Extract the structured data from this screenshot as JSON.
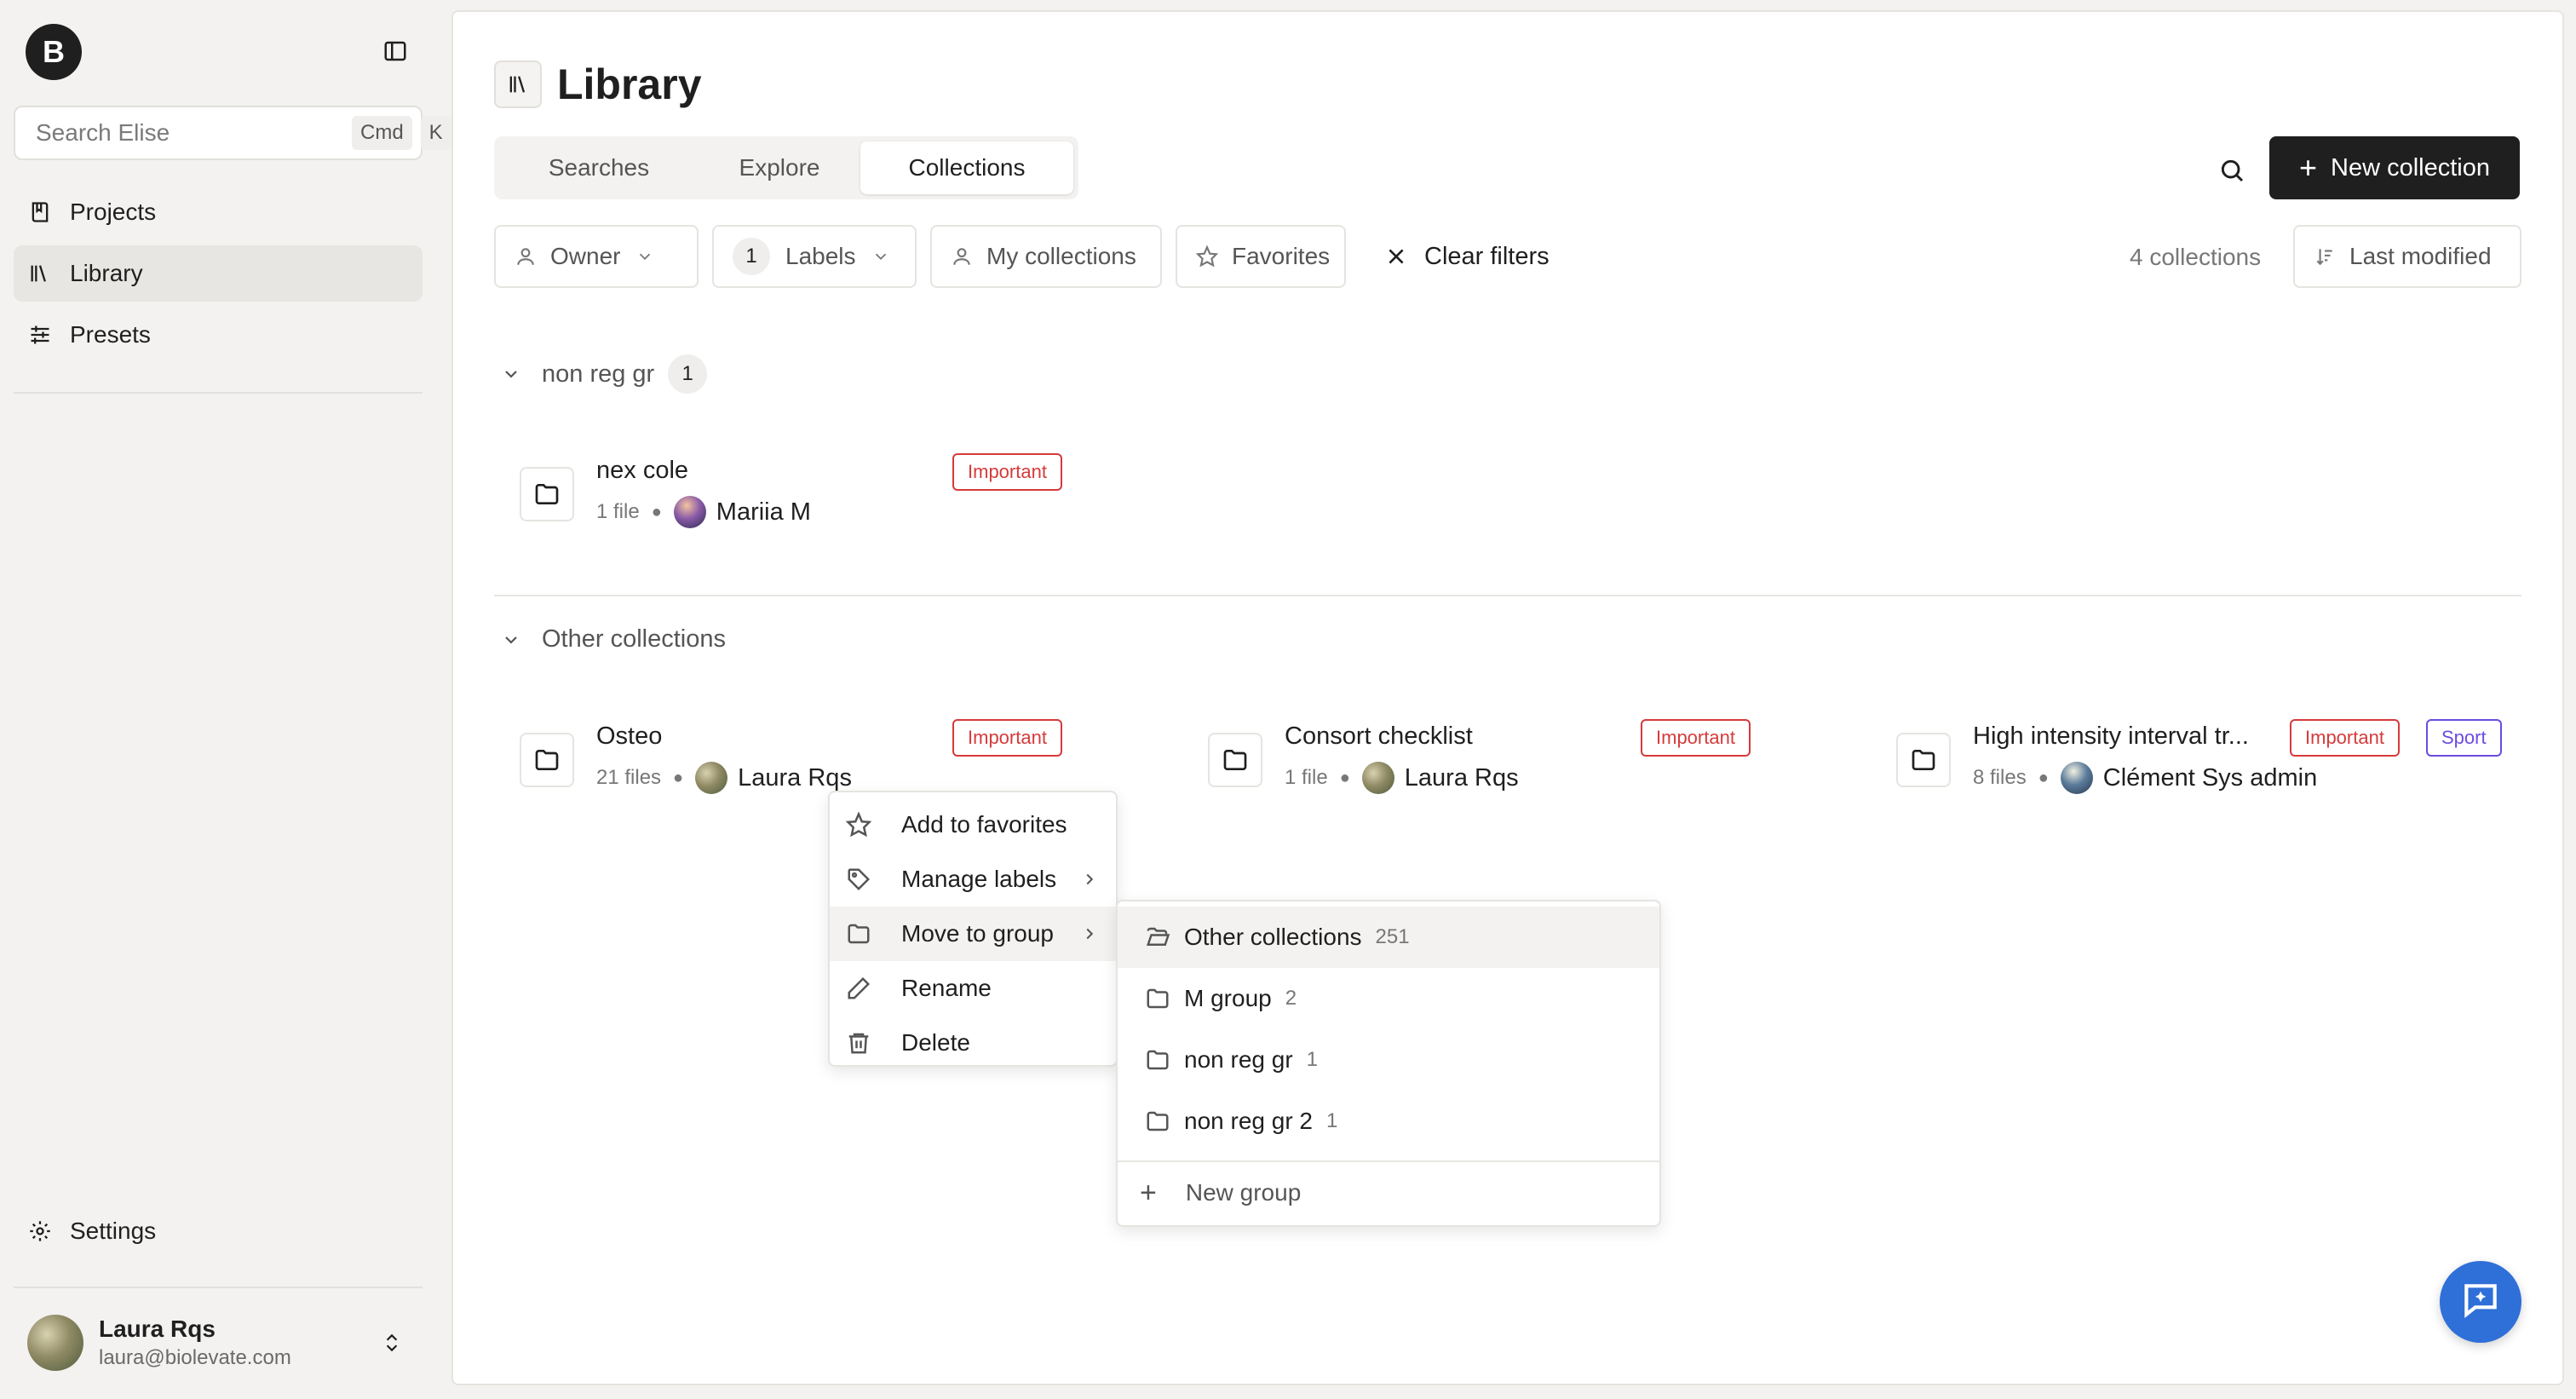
{
  "sidebar": {
    "logo": "B",
    "search": {
      "placeholder": "Search Elise",
      "kbd1": "Cmd",
      "kbd2": "K"
    },
    "nav": [
      {
        "label": "Projects",
        "icon": "book-icon"
      },
      {
        "label": "Library",
        "icon": "library-icon",
        "active": true
      },
      {
        "label": "Presets",
        "icon": "sliders-icon"
      }
    ],
    "settings_label": "Settings",
    "user": {
      "name": "Laura Rqs",
      "email": "laura@biolevate.com"
    }
  },
  "header": {
    "title": "Library",
    "tabs": [
      "Searches",
      "Explore",
      "Collections"
    ],
    "active_tab": "Collections",
    "new_collection_label": "New collection"
  },
  "filters": {
    "owner": "Owner",
    "labels_count": "1",
    "labels": "Labels",
    "my_collections": "My collections",
    "favorites": "Favorites",
    "clear": "Clear filters",
    "count_text": "4 collections",
    "sort": "Last modified"
  },
  "groups": [
    {
      "name": "non reg gr",
      "count": "1",
      "collections": [
        {
          "name": "nex cole",
          "files": "1 file",
          "owner": "Mariia M",
          "tags": [
            "Important"
          ]
        }
      ]
    },
    {
      "name": "Other collections",
      "collections": [
        {
          "name": "Osteo",
          "files": "21 files",
          "owner": "Laura Rqs",
          "tags": [
            "Important"
          ]
        },
        {
          "name": "Consort checklist",
          "files": "1 file",
          "owner": "Laura Rqs",
          "tags": [
            "Important"
          ]
        },
        {
          "name": "High intensity interval tr...",
          "files": "8 files",
          "owner": "Clément Sys admin",
          "tags": [
            "Important",
            "Sport"
          ]
        }
      ]
    }
  ],
  "context_menu": {
    "items": [
      "Add to favorites",
      "Manage labels",
      "Move to group",
      "Rename",
      "Delete"
    ]
  },
  "move_submenu": {
    "items": [
      {
        "name": "Other collections",
        "count": "251"
      },
      {
        "name": "M group",
        "count": "2"
      },
      {
        "name": "non reg gr",
        "count": "1"
      },
      {
        "name": "non reg gr 2",
        "count": "1"
      }
    ],
    "new_group": "New group"
  },
  "colors": {
    "accent": "#1f1f1f",
    "tag_red": "#d63a3a",
    "tag_purple": "#6b4ce0",
    "fab": "#2f6fd8"
  }
}
